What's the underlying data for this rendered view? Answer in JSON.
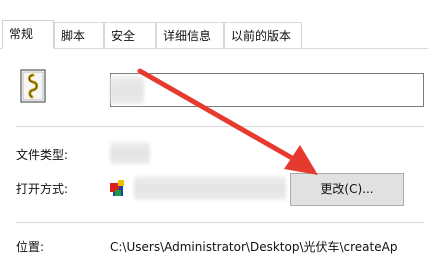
{
  "tabs": [
    {
      "label": "常规"
    },
    {
      "label": "脚本"
    },
    {
      "label": "安全"
    },
    {
      "label": "详细信息"
    },
    {
      "label": "以前的版本"
    }
  ],
  "general": {
    "file_type_label": "文件类型:",
    "open_with_label": "打开方式:",
    "change_button_label": "更改(C)...",
    "location_label": "位置:",
    "location_value": "C:\\Users\\Administrator\\Desktop\\光伏车\\createAp"
  },
  "colors": {
    "annotation_arrow": "#e63a2e"
  },
  "icons": {
    "file": "script-file-icon",
    "open_with_app": "app-icon"
  }
}
